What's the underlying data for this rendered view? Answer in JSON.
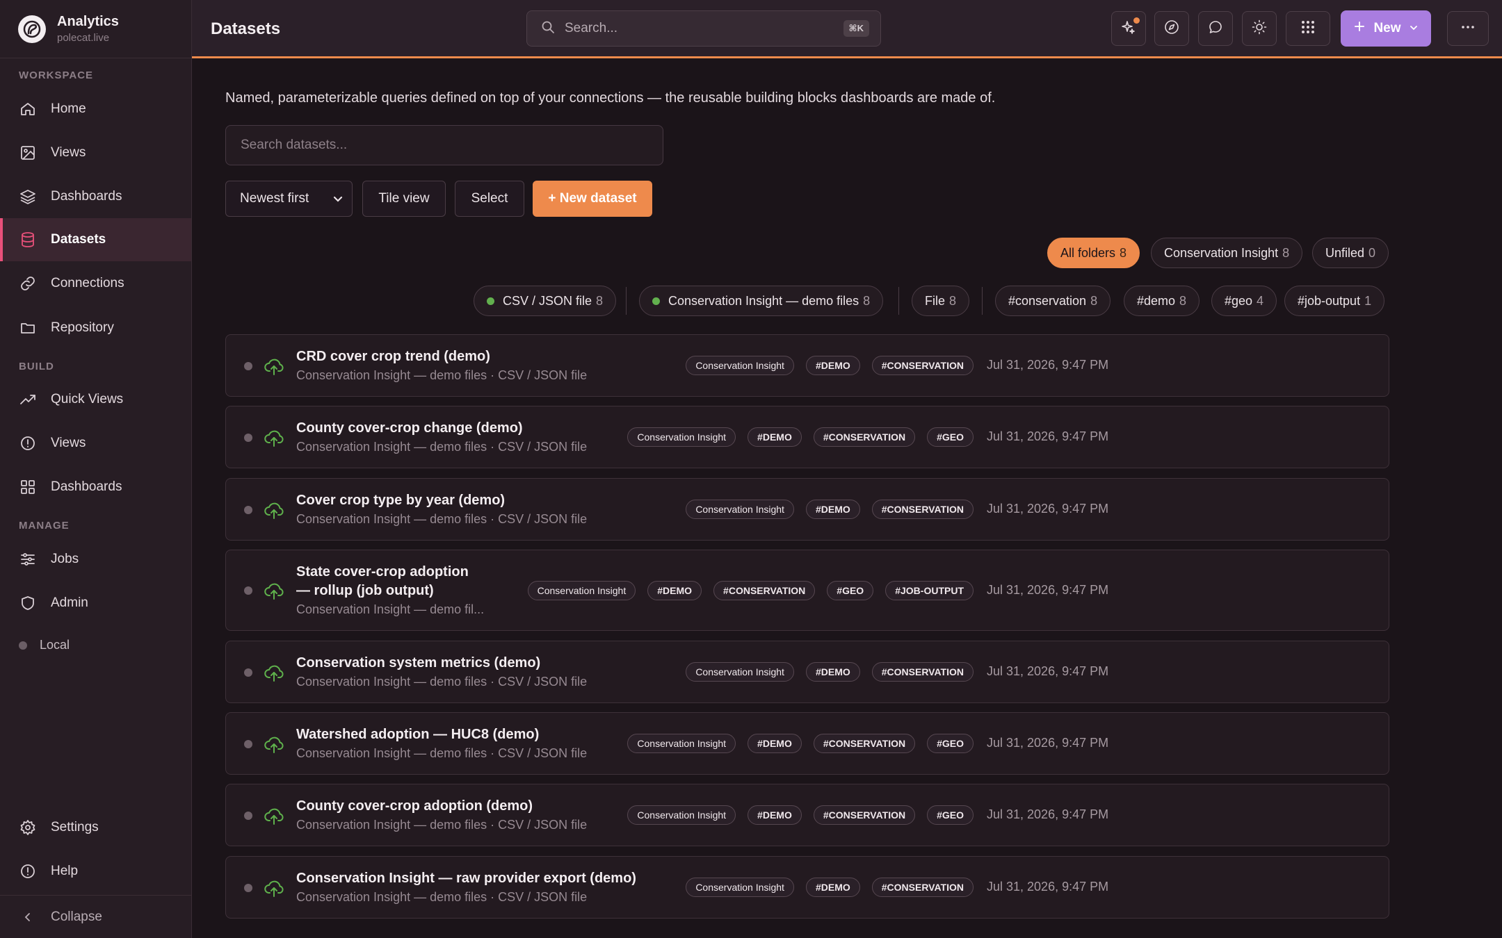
{
  "app": {
    "title": "Analytics",
    "subtitle": "polecat.live"
  },
  "sidebar": {
    "workspace_label": "WORKSPACE",
    "build_label": "BUILD",
    "manage_label": "MANAGE",
    "workspace": [
      {
        "label": "Home",
        "icon": "home-icon"
      },
      {
        "label": "Views",
        "icon": "image-icon"
      },
      {
        "label": "Dashboards",
        "icon": "layers-icon"
      },
      {
        "label": "Datasets",
        "icon": "database-icon",
        "active": true
      },
      {
        "label": "Connections",
        "icon": "link-icon"
      },
      {
        "label": "Repository",
        "icon": "folder-icon"
      }
    ],
    "build": [
      {
        "label": "Quick Views",
        "icon": "trend-icon"
      },
      {
        "label": "Views",
        "icon": "info-circle-icon"
      },
      {
        "label": "Dashboards",
        "icon": "grid-icon"
      }
    ],
    "manage": [
      {
        "label": "Jobs",
        "icon": "sliders-icon"
      },
      {
        "label": "Admin",
        "icon": "shield-icon"
      }
    ],
    "local_label": "Local",
    "settings_label": "Settings",
    "help_label": "Help",
    "collapse_label": "Collapse"
  },
  "header": {
    "page_title": "Datasets",
    "search_placeholder": "Search...",
    "search_shortcut": "⌘K",
    "new_label": "New",
    "accent": "#ee8a4c",
    "new_color": "#a97de0"
  },
  "main": {
    "intro": "Named, parameterizable queries defined on top of your connections — the reusable building blocks dashboards are made of.",
    "search_placeholder": "Search datasets...",
    "sort_value": "Newest first",
    "tile_view_label": "Tile view",
    "select_label": "Select",
    "new_dataset_label": "+ New dataset"
  },
  "folder_chips": [
    {
      "label": "All folders",
      "count": "8",
      "active": true
    },
    {
      "label": "Conservation Insight",
      "count": "8"
    },
    {
      "label": "Unfiled",
      "count": "0"
    }
  ],
  "filter_chips": {
    "type": {
      "label": "CSV / JSON file",
      "count": "8"
    },
    "source": {
      "label": "Conservation Insight — demo files",
      "count": "8"
    },
    "kind": {
      "label": "File",
      "count": "8"
    },
    "tags": [
      {
        "label": "#conservation",
        "count": "8"
      },
      {
        "label": "#demo",
        "count": "8"
      },
      {
        "label": "#geo",
        "count": "4"
      },
      {
        "label": "#job-output",
        "count": "1"
      }
    ]
  },
  "datasets": [
    {
      "name": "CRD cover crop trend (demo)",
      "sub": "Conservation Insight — demo files · CSV / JSON file",
      "folder": "Conservation Insight",
      "tags": [
        "#DEMO",
        "#CONSERVATION"
      ],
      "date": "Jul 31, 2026, 9:47 PM"
    },
    {
      "name": "County cover-crop change (demo)",
      "sub": "Conservation Insight — demo files · CSV / JSON file",
      "folder": "Conservation Insight",
      "tags": [
        "#DEMO",
        "#CONSERVATION",
        "#GEO"
      ],
      "date": "Jul 31, 2026, 9:47 PM"
    },
    {
      "name": "Cover crop type by year (demo)",
      "sub": "Conservation Insight — demo files · CSV / JSON file",
      "folder": "Conservation Insight",
      "tags": [
        "#DEMO",
        "#CONSERVATION"
      ],
      "date": "Jul 31, 2026, 9:47 PM"
    },
    {
      "name_line1": "State cover-crop adoption",
      "name_line2": "— rollup (job output)",
      "sub": "Conservation Insight — demo fil...",
      "folder": "Conservation Insight",
      "tags": [
        "#DEMO",
        "#CONSERVATION",
        "#GEO",
        "#JOB-OUTPUT"
      ],
      "date": "Jul 31, 2026, 9:47 PM"
    },
    {
      "name": "Conservation system metrics (demo)",
      "sub": "Conservation Insight — demo files · CSV / JSON file",
      "folder": "Conservation Insight",
      "tags": [
        "#DEMO",
        "#CONSERVATION"
      ],
      "date": "Jul 31, 2026, 9:47 PM"
    },
    {
      "name": "Watershed adoption — HUC8 (demo)",
      "sub": "Conservation Insight — demo files · CSV / JSON file",
      "folder": "Conservation Insight",
      "tags": [
        "#DEMO",
        "#CONSERVATION",
        "#GEO"
      ],
      "date": "Jul 31, 2026, 9:47 PM"
    },
    {
      "name": "County cover-crop adoption (demo)",
      "sub": "Conservation Insight — demo files · CSV / JSON file",
      "folder": "Conservation Insight",
      "tags": [
        "#DEMO",
        "#CONSERVATION",
        "#GEO"
      ],
      "date": "Jul 31, 2026, 9:47 PM"
    },
    {
      "name": "Conservation Insight — raw provider export (demo)",
      "sub": "Conservation Insight — demo files · CSV / JSON file",
      "folder": "Conservation Insight",
      "tags": [
        "#DEMO",
        "#CONSERVATION"
      ],
      "date": "Jul 31, 2026, 9:47 PM"
    }
  ]
}
